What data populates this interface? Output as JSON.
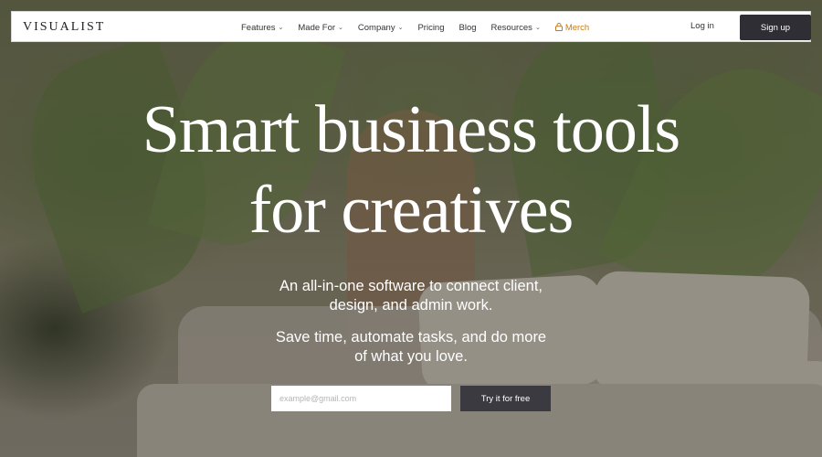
{
  "nav": {
    "logo": "VISUALIST",
    "items": [
      {
        "label": "Features",
        "dropdown": true
      },
      {
        "label": "Made For",
        "dropdown": true
      },
      {
        "label": "Company",
        "dropdown": true
      },
      {
        "label": "Pricing",
        "dropdown": false
      },
      {
        "label": "Blog",
        "dropdown": false
      },
      {
        "label": "Resources",
        "dropdown": true
      }
    ],
    "merch_label": "Merch",
    "login_label": "Log in",
    "signup_label": "Sign up"
  },
  "hero": {
    "headline_line1": "Smart business tools",
    "headline_line2": "for creatives",
    "subtitle1_line1": "An all-in-one software to connect client,",
    "subtitle1_line2": "design, and admin work.",
    "subtitle2_line1": "Save time, automate tasks, and do more",
    "subtitle2_line2": "of what you love.",
    "email_placeholder": "example@gmail.com",
    "cta_label": "Try it for free"
  },
  "colors": {
    "accent_merch": "#c27c1e",
    "button_dark": "#2e2e34"
  },
  "icons": {
    "dropdown": "chevron-down-icon",
    "merch": "lock-icon"
  }
}
